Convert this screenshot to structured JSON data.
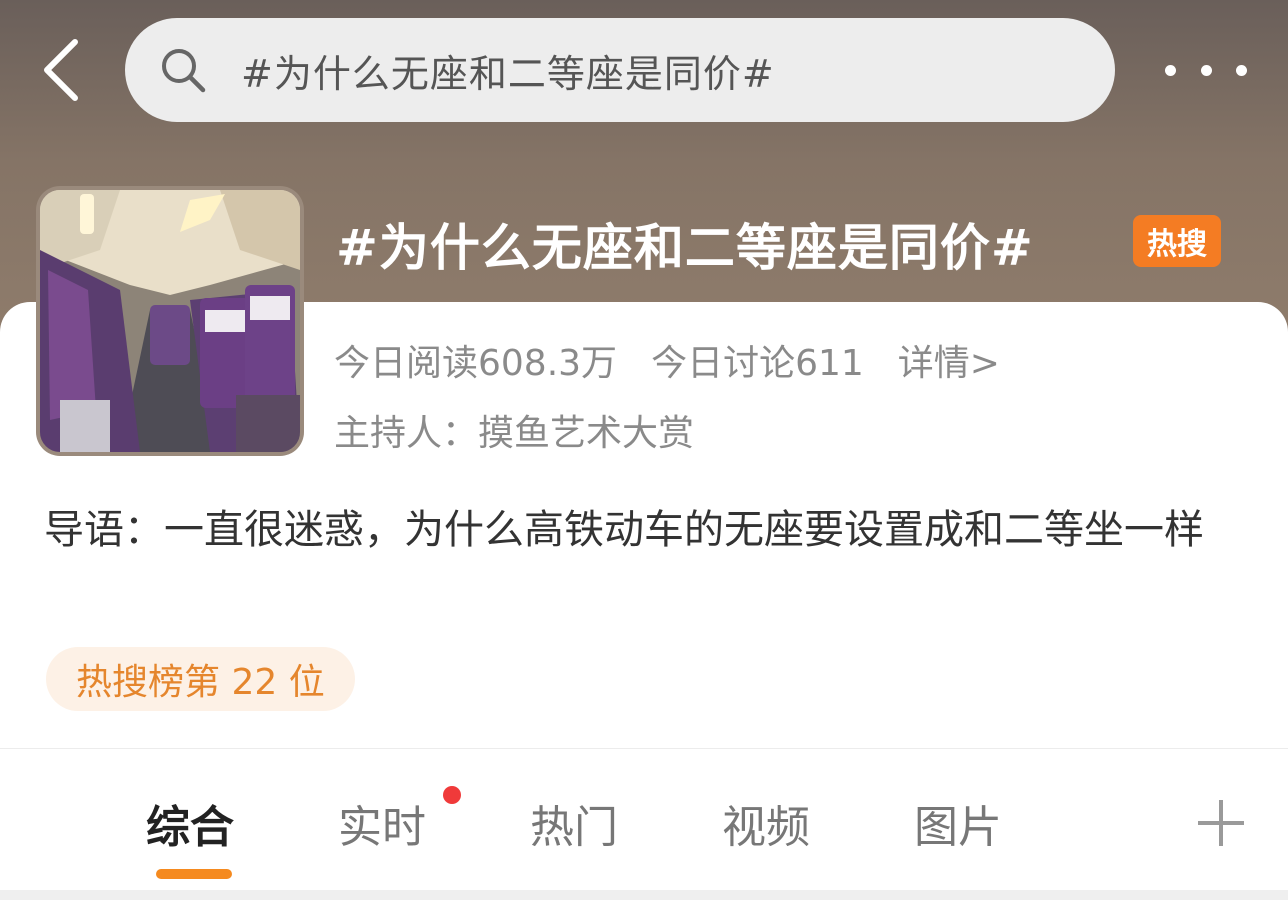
{
  "header": {
    "search_text": "#为什么无座和二等座是同价#",
    "back_icon": "chevron-left-icon",
    "search_icon": "search-icon",
    "more_icon": "more-dots-icon"
  },
  "topic": {
    "title": "#为什么无座和二等座是同价#",
    "hot_badge": "热搜",
    "stats": {
      "read": "今日阅读608.3万",
      "discuss": "今日讨论611",
      "detail": "详情>"
    },
    "host": "主持人：摸鱼艺术大赏",
    "intro": "导语：一直很迷惑，为什么高铁动车的无座要设置成和二等坐一样",
    "rank": "热搜榜第 22 位"
  },
  "tabs": [
    {
      "label": "综合"
    },
    {
      "label": "实时"
    },
    {
      "label": "热门"
    },
    {
      "label": "视频"
    },
    {
      "label": "图片"
    }
  ],
  "colors": {
    "accent": "#f58a1f",
    "hot_badge": "#f47c23",
    "notification_dot": "#f03a3a",
    "rank_text": "#e5862d"
  }
}
